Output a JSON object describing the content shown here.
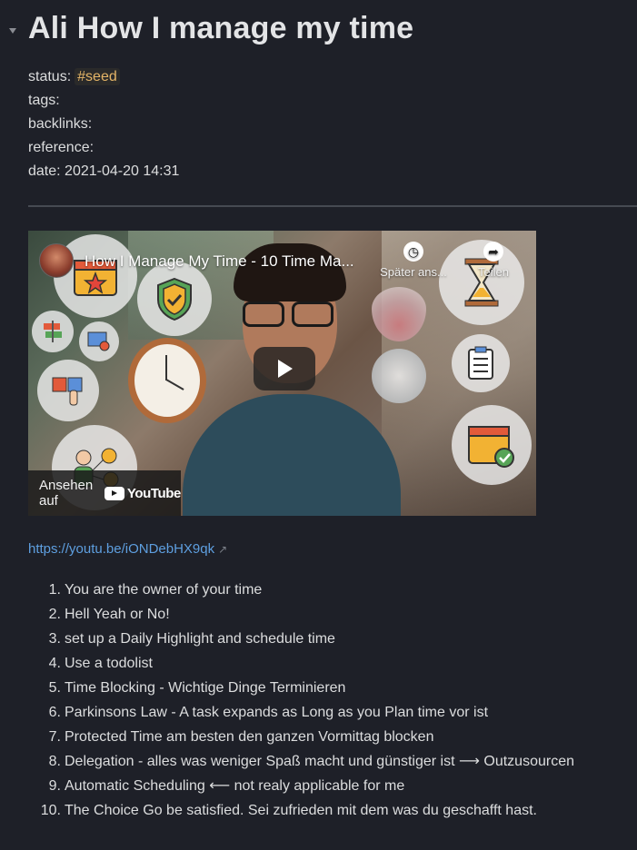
{
  "note": {
    "title": "Ali How I manage my time",
    "properties": {
      "status_label": "status:",
      "status_tag": "#seed",
      "tags_label": "tags:",
      "backlinks_label": "backlinks:",
      "reference_label": "reference:",
      "date_label": "date:",
      "date_value": "2021-04-20 14:31"
    },
    "video": {
      "title": "How I Manage My Time - 10 Time Ma...",
      "watch_later_label": "Später ans...",
      "share_label": "Teilen",
      "watch_on_label": "Ansehen auf",
      "youtube_logo_text": "YouTube"
    },
    "link": {
      "url_text": "https://youtu.be/iONDebHX9qk"
    },
    "list": [
      {
        "num": "1.",
        "text": "You are the owner of your time"
      },
      {
        "num": "2.",
        "text": "Hell Yeah or No!"
      },
      {
        "num": "3.",
        "text": "set up a Daily Highlight and schedule time"
      },
      {
        "num": "4.",
        "text": "Use a todolist"
      },
      {
        "num": "5.",
        "text": "Time Blocking - Wichtige Dinge Terminieren"
      },
      {
        "num": "6.",
        "text": "Parkinsons Law - A task expands as Long as you Plan time vor ist"
      },
      {
        "num": "7.",
        "text": "Protected Time am besten den ganzen Vormittag blocken"
      },
      {
        "num": "8.",
        "text": "Delegation - alles was weniger Spaß macht und günstiger ist ⟶ Outzusourcen"
      },
      {
        "num": "9.",
        "text": "Automatic Scheduling ⟵ not realy applicable for me"
      },
      {
        "num": "10.",
        "text": "The Choice Go be satisfied. Sei zufrieden mit dem was du geschafft hast."
      }
    ]
  },
  "colors": {
    "background": "#1e2028",
    "text": "#dcddde",
    "tag": "#e5b567",
    "link": "#5e9fe0"
  }
}
